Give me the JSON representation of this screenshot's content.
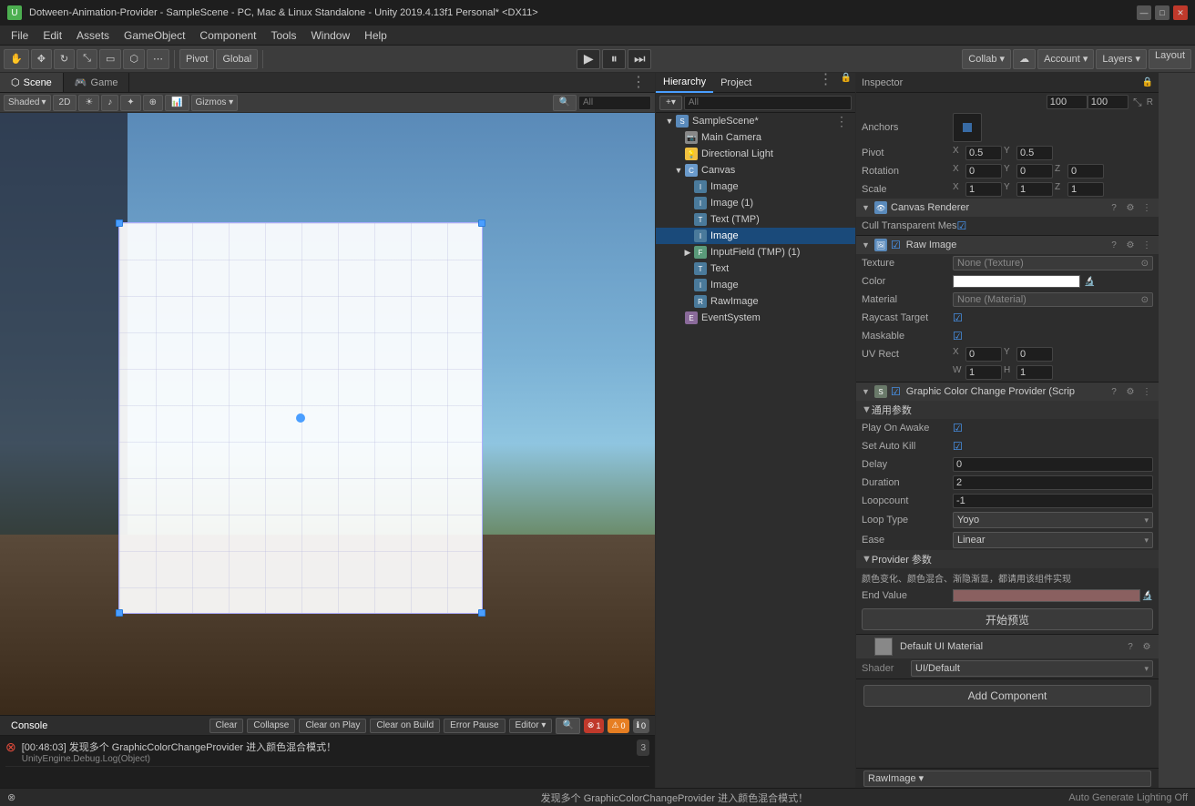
{
  "titleBar": {
    "title": "Dotween-Animation-Provider - SampleScene - PC, Mac & Linux Standalone - Unity 2019.4.13f1 Personal* <DX11>",
    "appIcon": "U"
  },
  "menuBar": {
    "items": [
      "File",
      "Edit",
      "Assets",
      "GameObject",
      "Component",
      "Tools",
      "Window",
      "Help"
    ]
  },
  "toolbar": {
    "pivotBtn": "Pivot",
    "globalBtn": "Global",
    "collabBtn": "Collab ▾",
    "accountBtn": "Account ▾",
    "layersBtn": "Layers ▾",
    "layoutBtn": "Layout"
  },
  "tabs": {
    "scene": "Scene",
    "game": "Game"
  },
  "sceneToolbar": {
    "shaded": "Shaded",
    "twod": "2D",
    "gizmos": "Gizmos ▾",
    "search": "All"
  },
  "hierarchy": {
    "headerTabs": [
      "Hierarchy",
      "Project"
    ],
    "searchPlaceholder": "All",
    "plusBtn": "+▾",
    "items": [
      {
        "id": "samplescene",
        "label": "SampleScene*",
        "level": 0,
        "hasArrow": true,
        "expanded": true,
        "iconType": "scene"
      },
      {
        "id": "maincamera",
        "label": "Main Camera",
        "level": 1,
        "hasArrow": false,
        "iconType": "cam"
      },
      {
        "id": "directionallight",
        "label": "Directional Light",
        "level": 1,
        "hasArrow": false,
        "iconType": "light"
      },
      {
        "id": "canvas",
        "label": "Canvas",
        "level": 1,
        "hasArrow": true,
        "expanded": true,
        "iconType": "canvas"
      },
      {
        "id": "image1",
        "label": "Image",
        "level": 2,
        "hasArrow": false,
        "iconType": "ui"
      },
      {
        "id": "image2",
        "label": "Image (1)",
        "level": 2,
        "hasArrow": false,
        "iconType": "ui"
      },
      {
        "id": "texttmp",
        "label": "Text (TMP)",
        "level": 2,
        "hasArrow": false,
        "iconType": "ui"
      },
      {
        "id": "image3",
        "label": "Image",
        "level": 2,
        "hasArrow": false,
        "iconType": "ui",
        "selected": true
      },
      {
        "id": "inputfield",
        "label": "InputField (TMP) (1)",
        "level": 2,
        "hasArrow": true,
        "expanded": false,
        "iconType": "input"
      },
      {
        "id": "text",
        "label": "Text",
        "level": 2,
        "hasArrow": false,
        "iconType": "ui"
      },
      {
        "id": "image4",
        "label": "Image",
        "level": 2,
        "hasArrow": false,
        "iconType": "ui"
      },
      {
        "id": "rawimage",
        "label": "RawImage",
        "level": 2,
        "hasArrow": false,
        "iconType": "ui"
      },
      {
        "id": "eventsystem",
        "label": "EventSystem",
        "level": 1,
        "hasArrow": false,
        "iconType": "event"
      }
    ]
  },
  "inspector": {
    "title": "Inspector",
    "anchorSection": {
      "label": "Anchors"
    },
    "pivot": {
      "label": "Pivot",
      "x": "0.5",
      "y": "0.5"
    },
    "rotation": {
      "label": "Rotation",
      "x": "0",
      "y": "0",
      "z": "0"
    },
    "scale": {
      "label": "Scale",
      "x": "1",
      "y": "1",
      "z": "1"
    },
    "canvasRenderer": {
      "title": "Canvas Renderer",
      "cullTransparentMes": "Cull Transparent Mes"
    },
    "rawImage": {
      "title": "Raw Image",
      "enabled": true,
      "texture": {
        "label": "Texture",
        "value": "None (Texture)"
      },
      "color": {
        "label": "Color"
      },
      "material": {
        "label": "Material",
        "value": "None (Material)"
      },
      "raycastTarget": {
        "label": "Raycast Target",
        "checked": true
      },
      "maskable": {
        "label": "Maskable",
        "checked": true
      },
      "uvRect": {
        "label": "UV Rect",
        "x": "0",
        "y": "0",
        "w": "1",
        "h": "1"
      }
    },
    "graphicColorChange": {
      "title": "Graphic Color Change Provider (Scrip",
      "enabled": true,
      "generalParams": "通用参数",
      "playOnAwake": {
        "label": "Play On Awake",
        "checked": true
      },
      "setAutoKill": {
        "label": "Set Auto Kill",
        "checked": true
      },
      "delay": {
        "label": "Delay",
        "value": "0"
      },
      "duration": {
        "label": "Duration",
        "value": "2"
      },
      "loopcount": {
        "label": "Loopcount",
        "value": "-1"
      },
      "loopType": {
        "label": "Loop Type",
        "value": "Yoyo"
      },
      "ease": {
        "label": "Ease",
        "value": "Linear"
      },
      "providerParams": "Provider 参数",
      "description": "颜色变化、颜色混合、渐隐渐显，都请用该组件实现",
      "endValue": {
        "label": "End Value"
      },
      "previewBtn": "开始预览"
    },
    "defaultUIMaterial": {
      "title": "Default UI Material",
      "shader": {
        "label": "Shader",
        "value": "UI/Default"
      }
    },
    "addComponent": "Add Component",
    "rawImageBottom": "RawImage ▾"
  },
  "console": {
    "tab": "Console",
    "buttons": [
      "Clear",
      "Collapse",
      "Clear on Play",
      "Clear on Build",
      "Error Pause"
    ],
    "editorBtn": "Editor ▾",
    "badges": {
      "error": "1",
      "warn": "0",
      "info": "0"
    },
    "messages": [
      {
        "type": "error",
        "text": "[00:48:03] 发现多个 GraphicColorChangeProvider 进入颜色混合模式！",
        "subtext": "UnityEngine.Debug.Log(Object)",
        "count": "3"
      }
    ]
  },
  "statusBar": {
    "message": "发现多个 GraphicColorChangeProvider 进入颜色混合模式！",
    "right": "Auto Generate Lighting Off"
  }
}
